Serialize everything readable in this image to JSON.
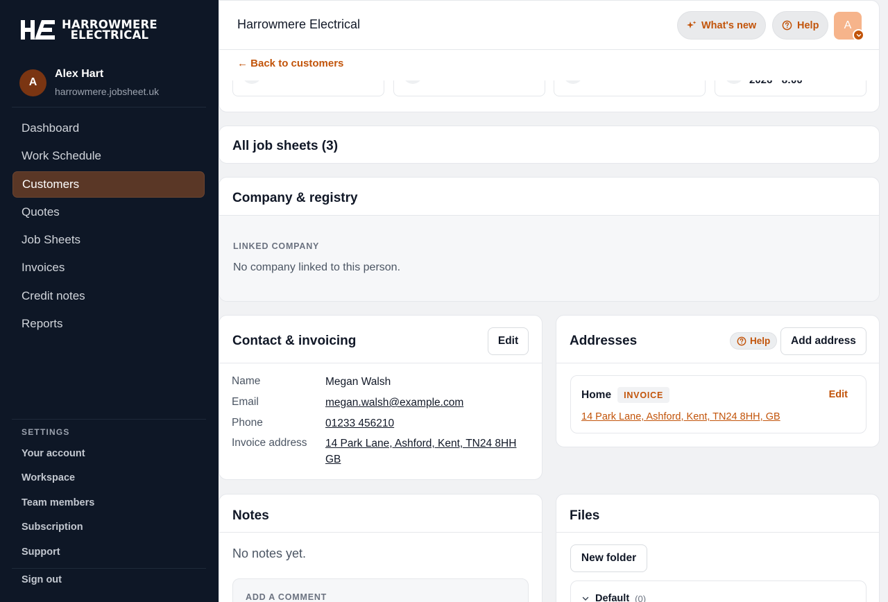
{
  "brand": {
    "line1": "HARROWMERE",
    "line2": "ELECTRICAL"
  },
  "user": {
    "initial": "A",
    "name": "Alex Hart",
    "domain": "harrowmere.jobsheet.uk"
  },
  "nav": [
    {
      "label": "Dashboard",
      "active": false
    },
    {
      "label": "Work Schedule",
      "active": false
    },
    {
      "label": "Customers",
      "active": true
    },
    {
      "label": "Quotes",
      "active": false
    },
    {
      "label": "Job Sheets",
      "active": false
    },
    {
      "label": "Invoices",
      "active": false
    },
    {
      "label": "Credit notes",
      "active": false
    },
    {
      "label": "Reports",
      "active": false
    }
  ],
  "settings": {
    "title": "SETTINGS",
    "items": [
      "Your account",
      "Workspace",
      "Team members",
      "Subscription",
      "Support"
    ],
    "signout": "Sign out"
  },
  "topbar": {
    "title": "Harrowmere Electrical",
    "whats_new": "What's new",
    "help": "Help",
    "avatar_initial": "A"
  },
  "back_link": "← Back to customers",
  "stats": {
    "last_visible": "2026 · 8:00"
  },
  "job_sheets": {
    "title": "All job sheets (3)"
  },
  "company": {
    "title": "Company & registry",
    "linked_label": "LINKED COMPANY",
    "empty": "No company linked to this person."
  },
  "contact": {
    "title": "Contact & invoicing",
    "edit": "Edit",
    "name_label": "Name",
    "name": "Megan Walsh",
    "email_label": "Email",
    "email": "megan.walsh@example.com",
    "phone_label": "Phone",
    "phone": "01233 456210",
    "address_label": "Invoice address",
    "address": "14 Park Lane, Ashford, Kent, TN24 8HH GB"
  },
  "addresses": {
    "title": "Addresses",
    "help": "Help",
    "add": "Add address",
    "item": {
      "name": "Home",
      "tag": "INVOICE",
      "edit": "Edit",
      "address": "14 Park Lane, Ashford, Kent, TN24 8HH, GB"
    }
  },
  "notes": {
    "title": "Notes",
    "empty": "No notes yet.",
    "comment_label": "ADD A COMMENT"
  },
  "files": {
    "title": "Files",
    "new_folder": "New folder",
    "folder_name": "Default",
    "folder_count": "(0)"
  },
  "colors": {
    "accent": "#c2540a",
    "sidebar": "#0e1726",
    "active_nav": "#5a3726"
  }
}
